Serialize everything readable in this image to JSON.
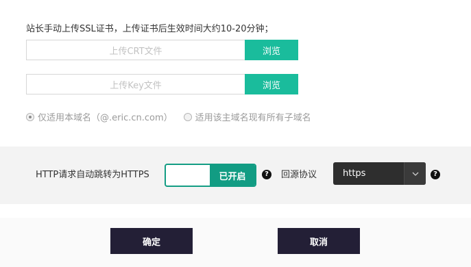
{
  "intro_text": "站长手动上传SSL证书，上传证书后生效时间大约10-20分钟；",
  "uploads": {
    "crt": {
      "placeholder": "上传CRT文件",
      "browse_label": "浏览"
    },
    "key": {
      "placeholder": "上传Key文件",
      "browse_label": "浏览"
    }
  },
  "scope": {
    "options": [
      {
        "label": "仅适用本域名（@.eric.cn.com）",
        "checked": true
      },
      {
        "label": "适用该主域名现有所有子域名",
        "checked": false
      }
    ]
  },
  "https_redirect": {
    "label": "HTTP请求自动跳转为HTTPS",
    "toggle_state": "已开启",
    "enabled": true,
    "help_glyph": "?"
  },
  "origin_protocol": {
    "label": "回源协议",
    "selected": "https",
    "help_glyph": "?"
  },
  "actions": {
    "confirm": "确定",
    "cancel": "取消"
  },
  "colors": {
    "accent": "#1abc9c",
    "toggle_on": "#129c83",
    "dark_button": "#231f36",
    "select_bg": "#2e2e2e"
  },
  "icons": {
    "help": "question-circle-icon",
    "dropdown": "chevron-down-icon",
    "radio": "radio-icon"
  }
}
